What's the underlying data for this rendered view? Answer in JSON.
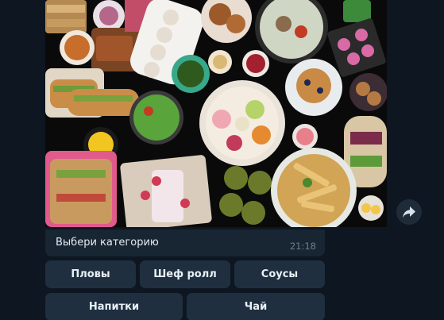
{
  "message": {
    "caption": "Выбери категорию",
    "time": "21:18"
  },
  "keyboard": {
    "rows": [
      [
        "Пловы",
        "Шеф ролл",
        "Соусы"
      ],
      [
        "Напитки",
        "Чай"
      ]
    ]
  },
  "icons": {
    "share": "share-arrow-icon"
  },
  "colors": {
    "background": "#0e1621",
    "bubble": "#182533",
    "button": "#1f2f3f",
    "text": "#e4ecf2",
    "time": "#6d7f8f"
  }
}
